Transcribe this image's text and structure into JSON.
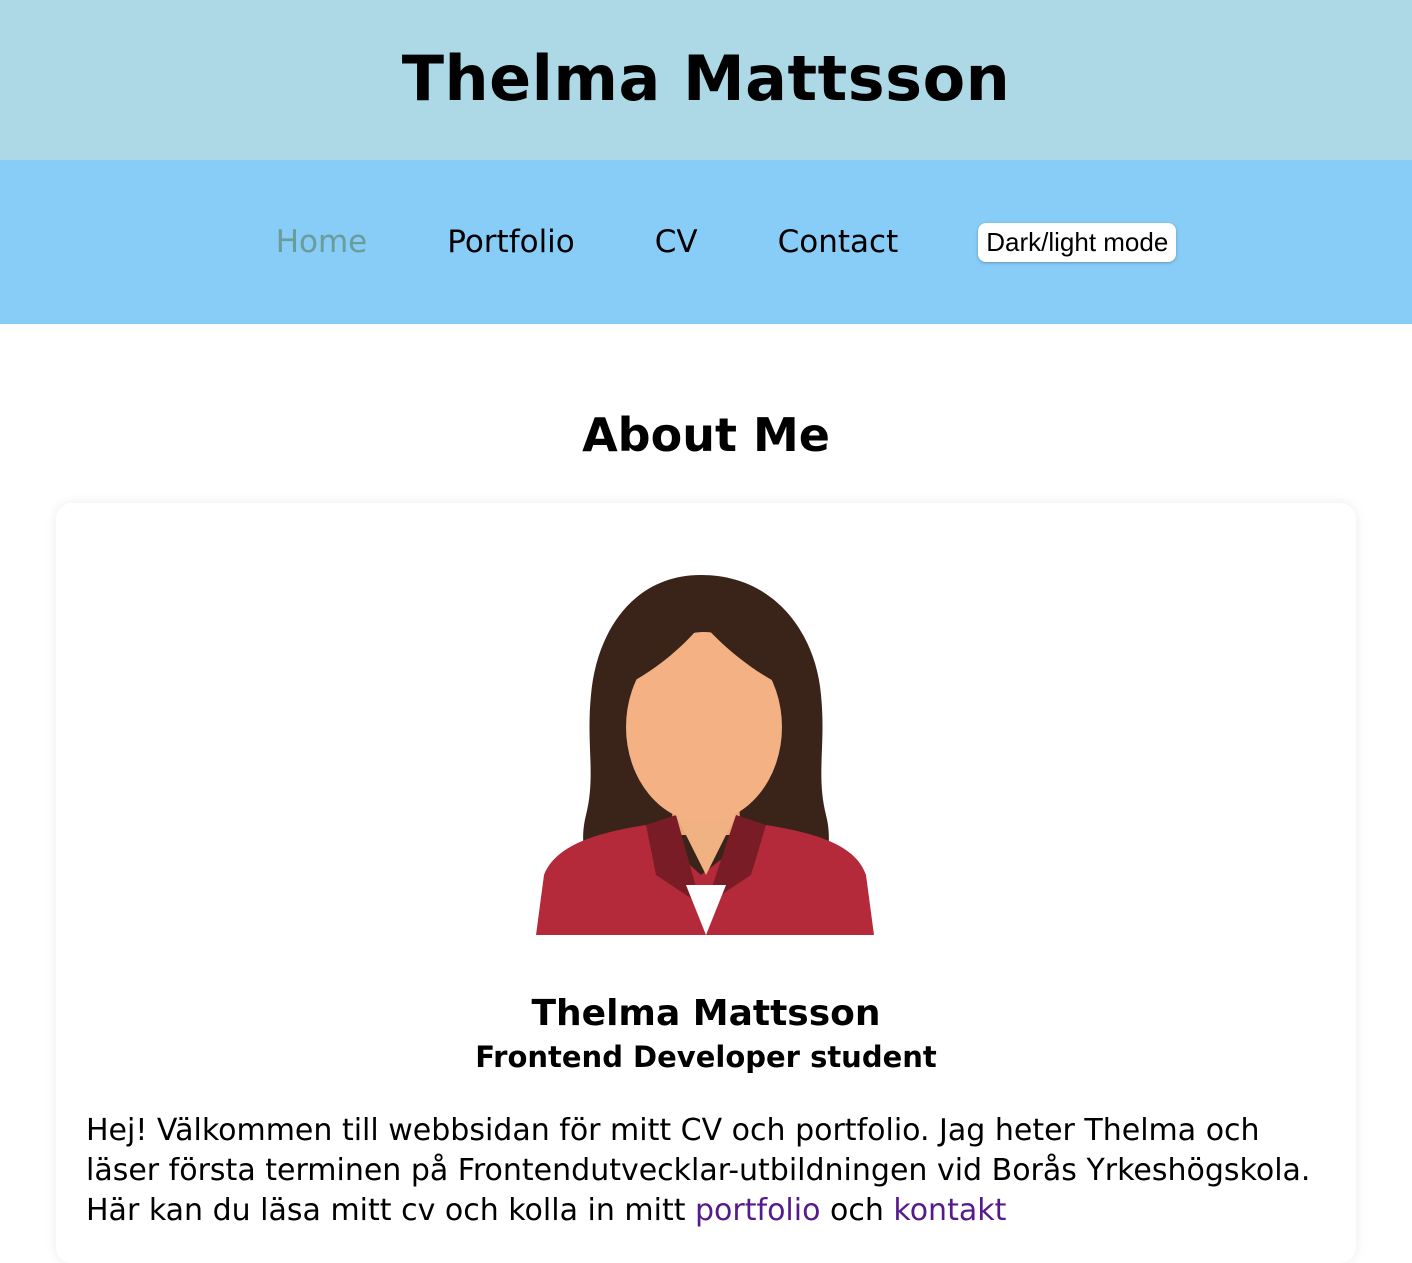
{
  "header": {
    "title": "Thelma Mattsson"
  },
  "nav": {
    "items": [
      {
        "label": "Home",
        "active": true
      },
      {
        "label": "Portfolio"
      },
      {
        "label": "CV"
      },
      {
        "label": "Contact"
      }
    ],
    "mode_toggle_label": "Dark/light mode"
  },
  "about": {
    "heading": "About Me",
    "avatar_icon": "female-avatar-icon",
    "name": "Thelma Mattsson",
    "role": "Frontend Developer student",
    "intro_text": "Hej! Välkommen till webbsidan för mitt CV och portfolio. Jag heter Thelma och läser första terminen på Frontendutvecklar-utbildningen vid Borås",
    "link_portfolio": "portfolio",
    "link_contact": "kontakt"
  },
  "colors": {
    "header_bg": "#add8e6",
    "nav_bg": "#87cdf7",
    "nav_active": "#6a9c9a",
    "link": "#551a8b"
  }
}
